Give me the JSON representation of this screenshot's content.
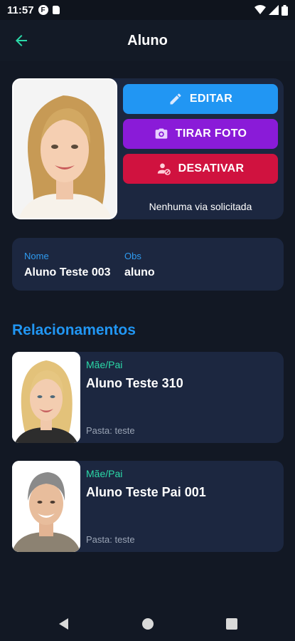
{
  "status_bar": {
    "time": "11:57",
    "badge": "F"
  },
  "app_bar": {
    "title": "Aluno"
  },
  "profile": {
    "edit_label": "EDITAR",
    "photo_label": "TIRAR FOTO",
    "deactivate_label": "DESATIVAR",
    "via_status": "Nenhuma via solicitada"
  },
  "info": {
    "name_label": "Nome",
    "name_value": "Aluno Teste 003",
    "obs_label": "Obs",
    "obs_value": "aluno"
  },
  "relationships": {
    "title": "Relacionamentos",
    "items": [
      {
        "role": "Mãe/Pai",
        "name": "Aluno Teste 310",
        "folder": "Pasta: teste"
      },
      {
        "role": "Mãe/Pai",
        "name": "Aluno Teste Pai 001",
        "folder": "Pasta: teste"
      }
    ]
  },
  "colors": {
    "background": "#121824",
    "card": "#1c2740",
    "accent_blue": "#2196f3",
    "accent_purple": "#8a1bd8",
    "accent_red": "#d0123f",
    "accent_teal": "#2bd9a8"
  }
}
